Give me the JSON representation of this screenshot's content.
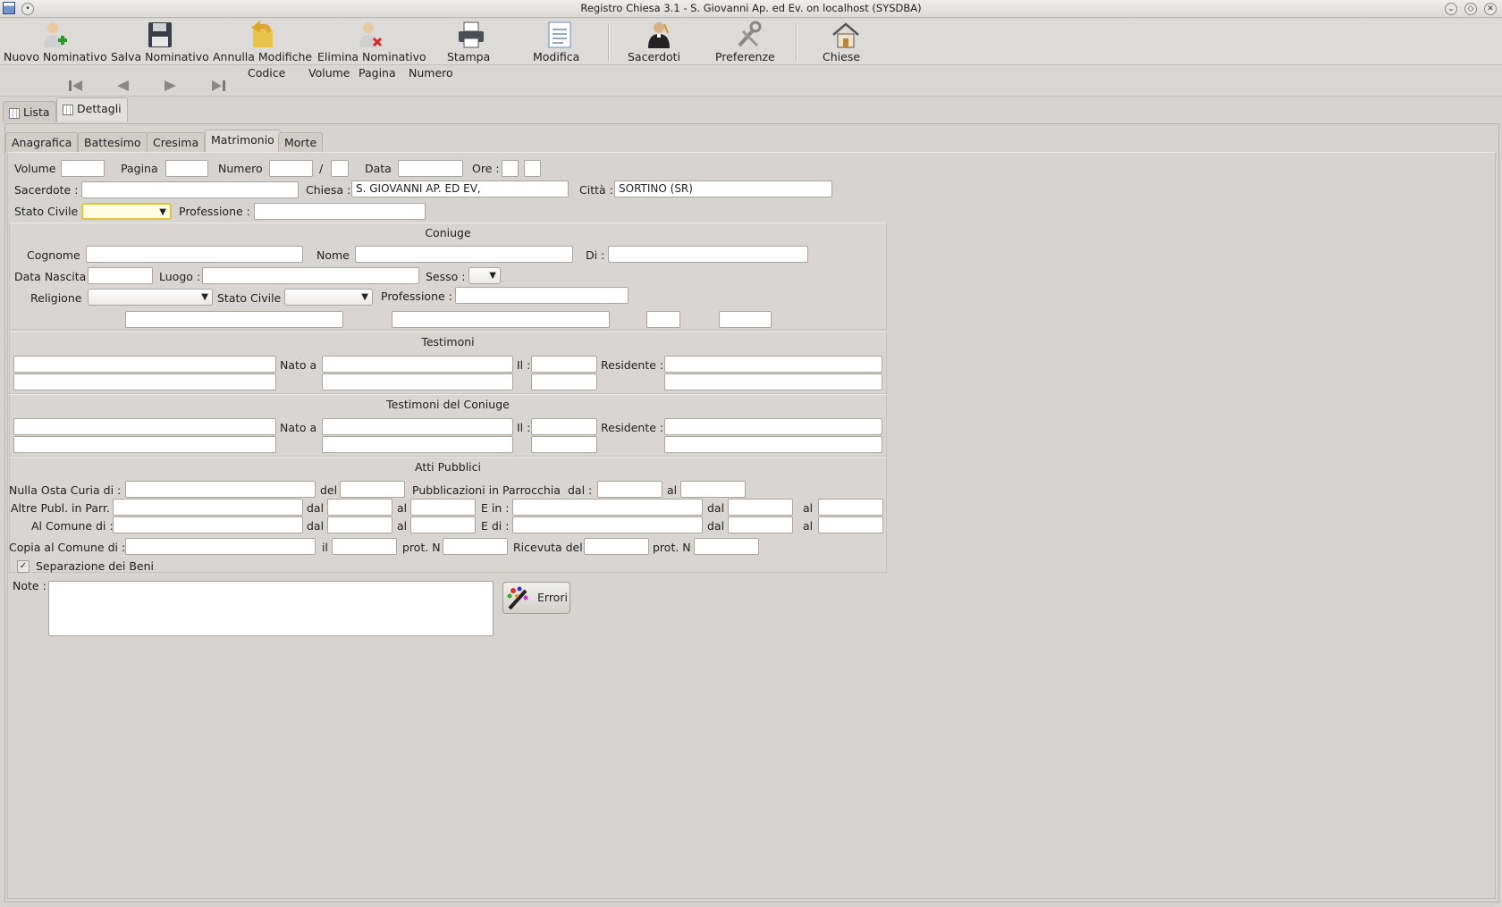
{
  "window": {
    "title": "Registro Chiesa 3.1 - S. Giovanni Ap. ed Ev. on localhost (SYSDBA)"
  },
  "toolbar": {
    "nuovo": "Nuovo Nominativo",
    "salva": "Salva Nominativo",
    "annulla": "Annulla Modifiche",
    "elimina": "Elimina Nominativo",
    "stampa": "Stampa",
    "modifica": "Modifica",
    "sacerdoti": "Sacerdoti",
    "preferenze": "Preferenze",
    "chiese": "Chiese"
  },
  "nav": {
    "codice": "Codice",
    "volume": "Volume",
    "pagina": "Pagina",
    "numero": "Numero"
  },
  "outer_tabs": {
    "lista": "Lista",
    "dettagli": "Dettagli"
  },
  "inner_tabs": {
    "anagrafica": "Anagrafica",
    "battesimo": "Battesimo",
    "cresima": "Cresima",
    "matrimonio": "Matrimonio",
    "morte": "Morte"
  },
  "header": {
    "volume": "Volume",
    "pagina": "Pagina",
    "numero": "Numero",
    "slash": "/",
    "data": "Data",
    "ore": "Ore :",
    "sacerdote": "Sacerdote :",
    "chiesa": "Chiesa :",
    "chiesa_value": "S. GIOVANNI AP. ED EV,",
    "citta": "Città :",
    "citta_value": "SORTINO (SR)",
    "stato_civile": "Stato Civile",
    "professione": "Professione :"
  },
  "coniuge": {
    "title": "Coniuge",
    "cognome": "Cognome",
    "nome": "Nome",
    "di": "Di :",
    "data_nascita": "Data Nascita",
    "luogo": "Luogo :",
    "sesso": "Sesso :",
    "religione": "Religione",
    "stato_civile": "Stato Civile",
    "professione": "Professione :"
  },
  "testimoni": {
    "title": "Testimoni",
    "nato_a": "Nato a",
    "il": "Il :",
    "residente": "Residente :"
  },
  "testimoni_coniuge": {
    "title": "Testimoni del Coniuge",
    "nato_a": "Nato a",
    "il": "Il :",
    "residente": "Residente :"
  },
  "atti": {
    "title": "Atti Pubblici",
    "nulla_osta": "Nulla Osta Curia di :",
    "del": "del",
    "pubblicazioni": "Pubblicazioni in Parrocchia",
    "dal_colon": "dal :",
    "al": "al",
    "altre": "Altre Publ. in Parr.",
    "dal": "dal",
    "e_in": "E in :",
    "comune": "Al Comune di :",
    "e_di": "E di :",
    "copia": "Copia al Comune di :",
    "il": "il",
    "prot": "prot. N",
    "ricevuta": "Ricevuta del"
  },
  "separazione": "Separazione dei Beni",
  "note": "Note :",
  "errori": "Errori"
}
